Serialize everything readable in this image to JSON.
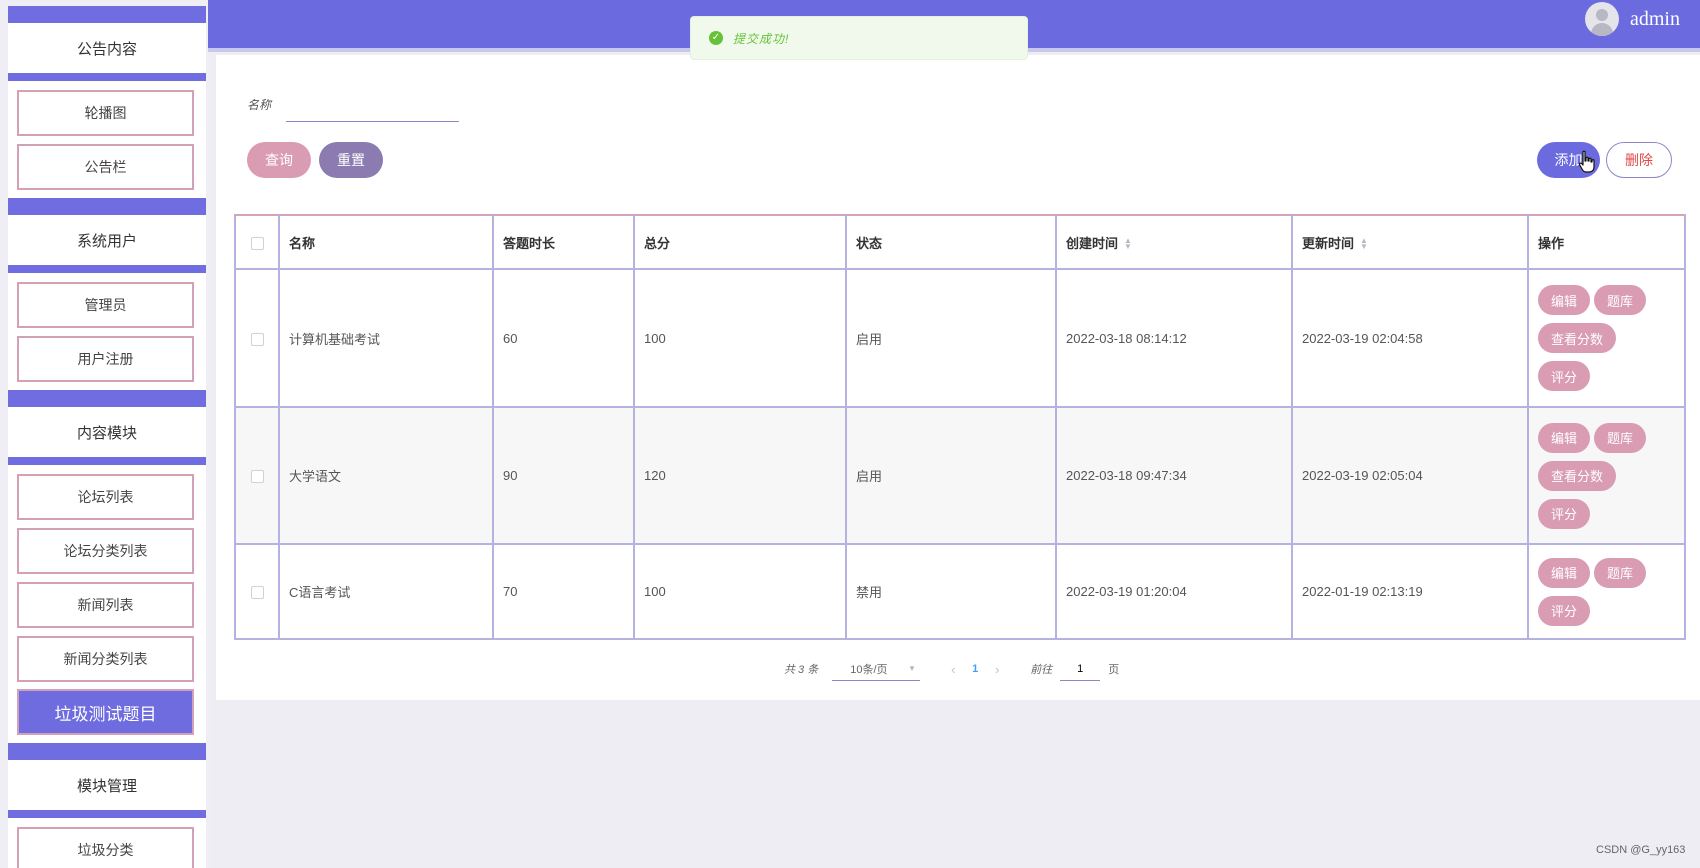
{
  "sidebar": {
    "groups": [
      {
        "label": "公告内容"
      },
      {
        "label": "系统用户"
      },
      {
        "label": "内容模块"
      },
      {
        "label": "模块管理"
      }
    ],
    "items": [
      {
        "label": "轮播图"
      },
      {
        "label": "公告栏"
      },
      {
        "label": "管理员"
      },
      {
        "label": "用户注册"
      },
      {
        "label": "论坛列表"
      },
      {
        "label": "论坛分类列表"
      },
      {
        "label": "新闻列表"
      },
      {
        "label": "新闻分类列表"
      },
      {
        "label": "垃圾测试题目"
      },
      {
        "label": "垃圾分类"
      }
    ]
  },
  "header": {
    "username": "admin"
  },
  "toast": {
    "text": "提交成功!",
    "color": "#67c23a"
  },
  "search": {
    "label": "名称",
    "value": ""
  },
  "toolbar": {
    "query": "查询",
    "reset": "重置",
    "add": "添加",
    "delete": "删除"
  },
  "table": {
    "headers": [
      "名称",
      "答题时长",
      "总分",
      "状态",
      "创建时间",
      "更新时间",
      "操作"
    ],
    "rows": [
      {
        "name": "计算机基础考试",
        "duration": "60",
        "total": "100",
        "status": "启用",
        "created": "2022-03-18 08:14:12",
        "updated": "2022-03-19 02:04:58",
        "actions": [
          "编辑",
          "题库",
          "查看分数",
          "评分"
        ]
      },
      {
        "name": "大学语文",
        "duration": "90",
        "total": "120",
        "status": "启用",
        "created": "2022-03-18 09:47:34",
        "updated": "2022-03-19 02:05:04",
        "actions": [
          "编辑",
          "题库",
          "查看分数",
          "评分"
        ]
      },
      {
        "name": "C语言考试",
        "duration": "70",
        "total": "100",
        "status": "禁用",
        "created": "2022-03-19 01:20:04",
        "updated": "2022-01-19 02:13:19",
        "actions": [
          "编辑",
          "题库",
          "评分"
        ]
      }
    ]
  },
  "pagination": {
    "total": "共 3 条",
    "page_size": "10条/页",
    "current": "1",
    "goto_label": "前往",
    "goto_value": "1",
    "goto_suffix": "页"
  },
  "watermark": "CSDN @G_yy163",
  "colors": {
    "accent": "#6b6ade",
    "pink": "#d99cb3",
    "reset": "#8b7bb0"
  }
}
